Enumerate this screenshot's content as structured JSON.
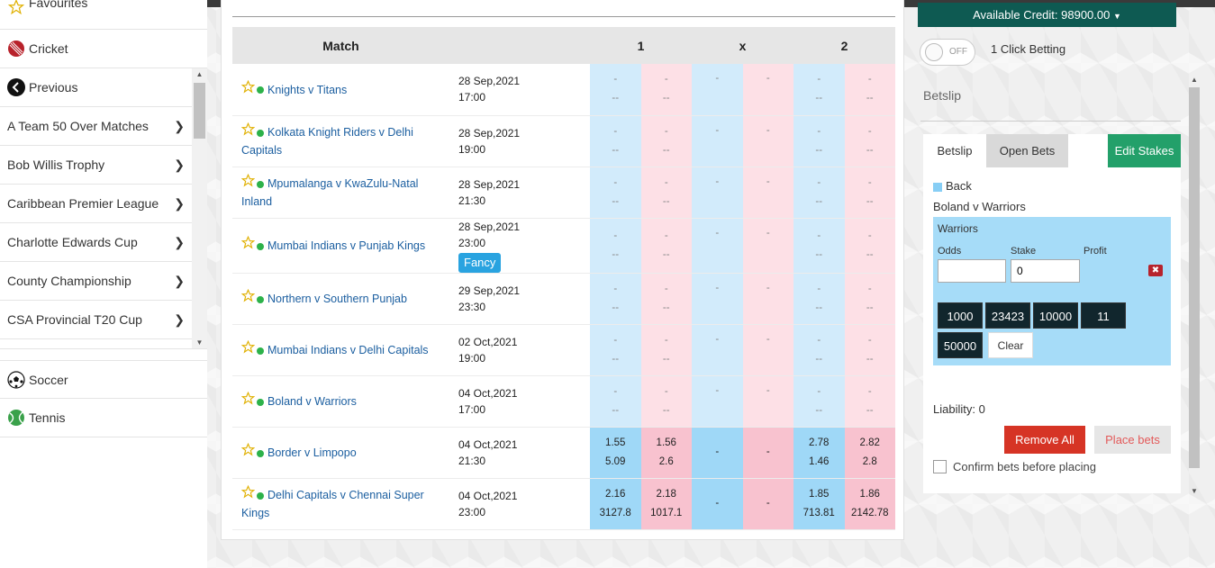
{
  "sidebar": {
    "favourites": "Favourites",
    "cricket": "Cricket",
    "previous": "Previous",
    "competitions": [
      "A Team 50 Over Matches",
      "Bob Willis Trophy",
      "Caribbean Premier League",
      "Charlotte Edwards Cup",
      "County Championship",
      "CSA Provincial T20 Cup"
    ],
    "soccer": "Soccer",
    "tennis": "Tennis"
  },
  "table": {
    "header_match": "Match",
    "header_1": "1",
    "header_x": "x",
    "header_2": "2",
    "fancy_label": "Fancy",
    "rows": [
      {
        "name": "Knights v Titans",
        "date": "28 Sep,2021",
        "time": "17:00"
      },
      {
        "name": "Kolkata Knight Riders v Delhi Capitals",
        "date": "28 Sep,2021",
        "time": "19:00"
      },
      {
        "name": "Mpumalanga v KwaZulu-Natal Inland",
        "date": "28 Sep,2021",
        "time": "21:30"
      },
      {
        "name": "Mumbai Indians v Punjab Kings",
        "date": "28 Sep,2021",
        "time": "23:00"
      },
      {
        "name": "Northern v Southern Punjab",
        "date": "29 Sep,2021",
        "time": "23:30"
      },
      {
        "name": "Mumbai Indians v Delhi Capitals",
        "date": "02 Oct,2021",
        "time": "19:00"
      },
      {
        "name": "Boland v Warriors",
        "date": "04 Oct,2021",
        "time": "17:00"
      },
      {
        "name": "Border v Limpopo",
        "date": "04 Oct,2021",
        "time": "21:30",
        "odds": {
          "b1": "1.55",
          "b1s": "5.09",
          "l1": "1.56",
          "l1s": "2.6",
          "bx": "-",
          "lx": "-",
          "b2": "2.78",
          "b2s": "1.46",
          "l2": "2.82",
          "l2s": "2.8"
        }
      },
      {
        "name": "Delhi Capitals v Chennai Super Kings",
        "date": "04 Oct,2021",
        "time": "23:00",
        "odds": {
          "b1": "2.16",
          "b1s": "3127.8",
          "l1": "2.18",
          "l1s": "1017.1",
          "bx": "-",
          "lx": "-",
          "b2": "1.85",
          "b2s": "713.81",
          "l2": "1.86",
          "l2s": "2142.78"
        }
      }
    ],
    "empty_dash": "-",
    "empty_double": "--"
  },
  "right": {
    "credit": "Available Credit: 98900.00",
    "toggle": "OFF",
    "one_click": "1 Click Betting",
    "betslip_title": "Betslip",
    "tabs": {
      "betslip": "Betslip",
      "open_bets": "Open Bets",
      "edit_stakes": "Edit Stakes"
    },
    "back_label": "Back",
    "bet_match": "Boland v Warriors",
    "runner": "Warriors",
    "odds_label": "Odds",
    "stake_label": "Stake",
    "profit_label": "Profit",
    "stake_value": "0",
    "stakes": [
      "1000",
      "23423",
      "10000",
      "11",
      "50000"
    ],
    "clear": "Clear",
    "liability": "Liability: 0",
    "remove_all": "Remove All",
    "place_bets": "Place bets",
    "confirm": "Confirm bets before placing"
  }
}
